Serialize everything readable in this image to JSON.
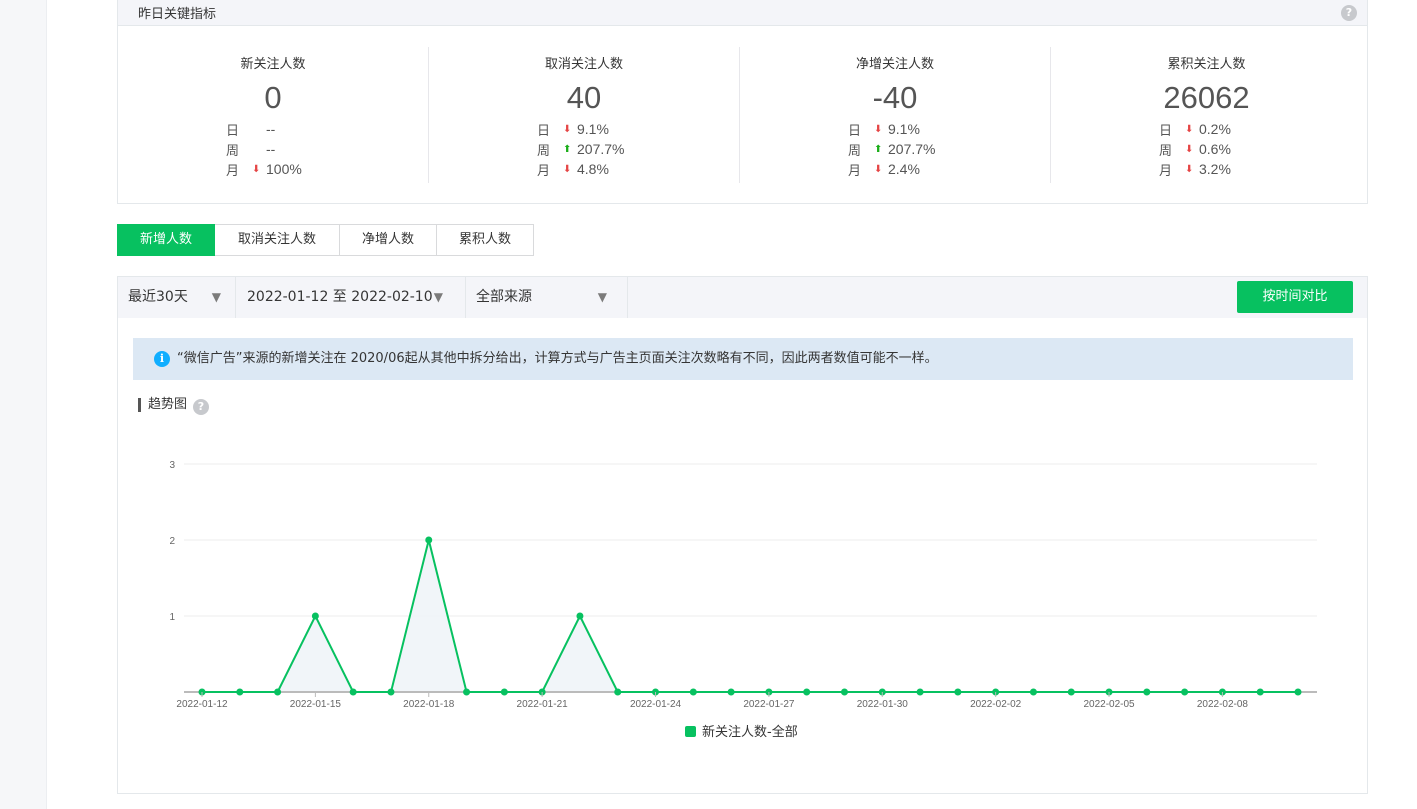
{
  "metrics": {
    "title": "昨日关键指标",
    "help": "?",
    "items": [
      {
        "label": "新关注人数",
        "value": "0",
        "rows": [
          {
            "label": "日",
            "dir": "",
            "value": "--"
          },
          {
            "label": "周",
            "dir": "",
            "value": "--"
          },
          {
            "label": "月",
            "dir": "down",
            "value": "100%"
          }
        ]
      },
      {
        "label": "取消关注人数",
        "value": "40",
        "rows": [
          {
            "label": "日",
            "dir": "down",
            "value": "9.1%"
          },
          {
            "label": "周",
            "dir": "up",
            "value": "207.7%"
          },
          {
            "label": "月",
            "dir": "down",
            "value": "4.8%"
          }
        ]
      },
      {
        "label": "净增关注人数",
        "value": "-40",
        "rows": [
          {
            "label": "日",
            "dir": "down",
            "value": "9.1%"
          },
          {
            "label": "周",
            "dir": "up",
            "value": "207.7%"
          },
          {
            "label": "月",
            "dir": "down",
            "value": "2.4%"
          }
        ]
      },
      {
        "label": "累积关注人数",
        "value": "26062",
        "rows": [
          {
            "label": "日",
            "dir": "down",
            "value": "0.2%"
          },
          {
            "label": "周",
            "dir": "down",
            "value": "0.6%"
          },
          {
            "label": "月",
            "dir": "down",
            "value": "3.2%"
          }
        ]
      }
    ]
  },
  "tabs": [
    {
      "label": "新增人数",
      "active": true
    },
    {
      "label": "取消关注人数",
      "active": false
    },
    {
      "label": "净增人数",
      "active": false
    },
    {
      "label": "累积人数",
      "active": false
    }
  ],
  "filters": {
    "period": "最近30天",
    "date_range": "2022-01-12 至 2022-02-10",
    "source": "全部来源",
    "compare_button": "按时间对比"
  },
  "notice": "“微信广告”来源的新增关注在 2020/06起从其他中拆分给出，计算方式与广告主页面关注次数略有不同，因此两者数值可能不一样。",
  "trend": {
    "title": "趋势图",
    "help": "?"
  },
  "colors": {
    "accent": "#07c160",
    "down": "#e54545",
    "up": "#1aad19",
    "info": "#10aeff"
  },
  "chart_data": {
    "type": "line",
    "x": [
      "2022-01-12",
      "2022-01-13",
      "2022-01-14",
      "2022-01-15",
      "2022-01-16",
      "2022-01-17",
      "2022-01-18",
      "2022-01-19",
      "2022-01-20",
      "2022-01-21",
      "2022-01-22",
      "2022-01-23",
      "2022-01-24",
      "2022-01-25",
      "2022-01-26",
      "2022-01-27",
      "2022-01-28",
      "2022-01-29",
      "2022-01-30",
      "2022-01-31",
      "2022-02-01",
      "2022-02-02",
      "2022-02-03",
      "2022-02-04",
      "2022-02-05",
      "2022-02-06",
      "2022-02-07",
      "2022-02-08",
      "2022-02-09",
      "2022-02-10"
    ],
    "xticks": [
      "2022-01-12",
      "2022-01-15",
      "2022-01-18",
      "2022-01-21",
      "2022-01-24",
      "2022-01-27",
      "2022-01-30",
      "2022-02-02",
      "2022-02-05",
      "2022-02-08"
    ],
    "series": [
      {
        "name": "新关注人数-全部",
        "values": [
          0,
          0,
          0,
          1,
          0,
          0,
          2,
          0,
          0,
          0,
          1,
          0,
          0,
          0,
          0,
          0,
          0,
          0,
          0,
          0,
          0,
          0,
          0,
          0,
          0,
          0,
          0,
          0,
          0,
          0
        ]
      }
    ],
    "yticks": [
      1,
      2,
      3
    ],
    "ylim": [
      0,
      3
    ],
    "grid": true,
    "legend": "bottom"
  }
}
